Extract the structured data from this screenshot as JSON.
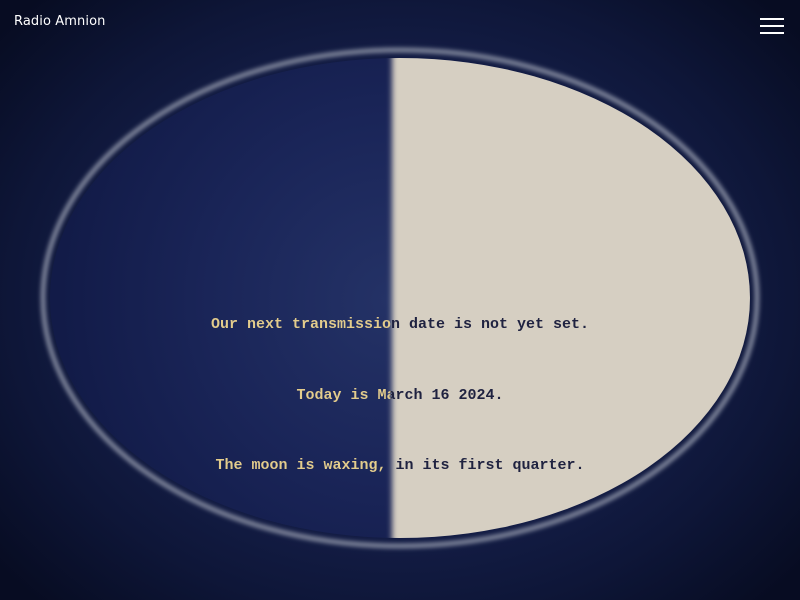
{
  "header": {
    "site_title": "Radio Amnion",
    "menu_icon": "hamburger-menu-icon"
  },
  "moon": {
    "phase": "first quarter",
    "illuminated_fraction": 0.5,
    "lit_side": "right",
    "colors": {
      "lit": "#d6cfc2",
      "dark": "#1d2a5e",
      "ring": "#7d8399",
      "background": "#0e1638",
      "text": "#e3cc8c"
    }
  },
  "message": {
    "line1": "Our next transmission date is not yet set.",
    "line2": "Today is March 16 2024.",
    "line3": "The moon is waxing, in its first quarter."
  }
}
